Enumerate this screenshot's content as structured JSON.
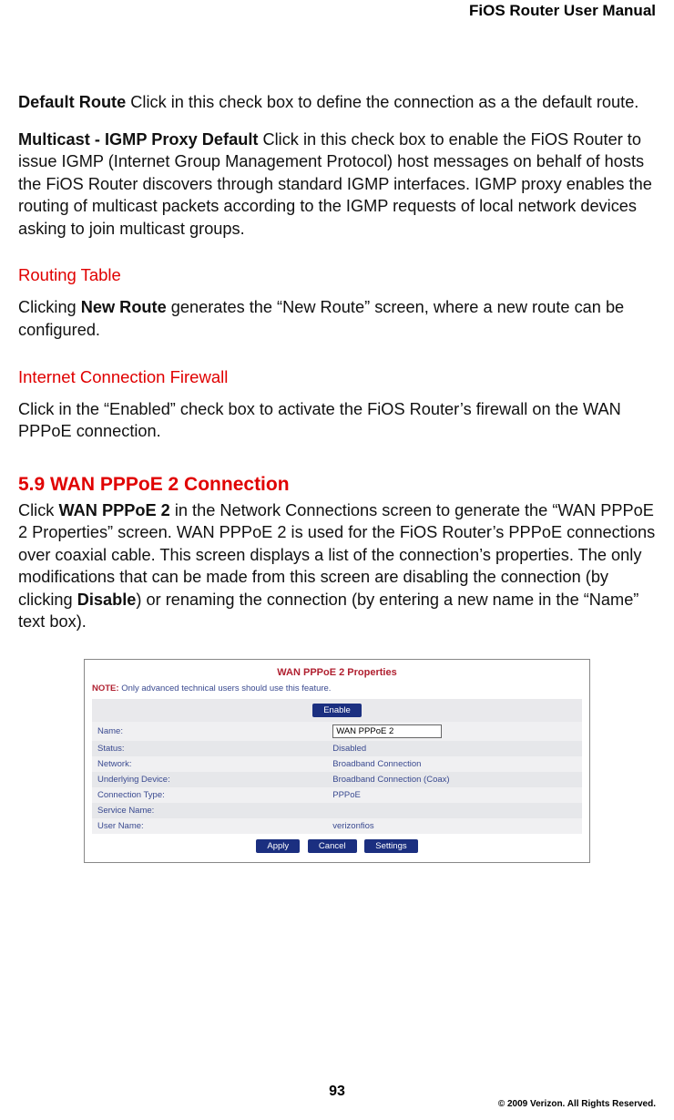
{
  "header": {
    "title": "FiOS Router User Manual"
  },
  "p1_bold": "Default Route",
  "p1_rest": "  Click in this check box to define the connection as a the default route.",
  "p2_bold": "Multicast - IGMP Proxy Default",
  "p2_rest": "  Click in this check box to enable the FiOS Router to issue IGMP (Internet Group Management Protocol) host messages on behalf of hosts the FiOS Router discovers through standard IGMP interfaces. IGMP proxy enables the routing of multicast packets according to the IGMP requests of local network devices asking to join multicast groups.",
  "routing_table_head": "Routing Table",
  "p3a": "Clicking ",
  "p3b": "New Route",
  "p3c": " generates the “New Route” screen, where a new route can be configured.",
  "icf_head": "Internet Connection Firewall",
  "p4": "Click in the “Enabled” check box to activate the FiOS Router’s firewall on the WAN PPPoE connection.",
  "sec59": "5.9  WAN PPPoE 2 Connection",
  "p5a": "Click ",
  "p5b": "WAN PPPoE 2",
  "p5c": " in the Network Connections screen to generate the “WAN PPPoE 2 Properties” screen.  WAN PPPoE 2 is used for the FiOS Router’s PPPoE connections over coaxial cable. This screen displays a list of the connection’s properties. The only modifications that can be made from this screen are disabling the connection (by clicking ",
  "p5d": "Disable",
  "p5e": ") or renaming the connection (by entering a new name in the “Name” text box).",
  "ss": {
    "title": "WAN PPPoE 2 Properties",
    "note_label": "NOTE:",
    "note_text": " Only advanced technical users should use this feature.",
    "enable_btn": "Enable",
    "rows": [
      {
        "k": "Name:",
        "v": "WAN PPPoE 2",
        "input": true
      },
      {
        "k": "Status:",
        "v": "Disabled"
      },
      {
        "k": "Network:",
        "v": "Broadband Connection"
      },
      {
        "k": "Underlying Device:",
        "v": "Broadband Connection (Coax)"
      },
      {
        "k": "Connection Type:",
        "v": "PPPoE"
      },
      {
        "k": "Service Name:",
        "v": ""
      },
      {
        "k": "User Name:",
        "v": "verizonfios"
      }
    ],
    "btns": {
      "apply": "Apply",
      "cancel": "Cancel",
      "settings": "Settings"
    }
  },
  "page_num": "93",
  "copyright": "© 2009 Verizon. All Rights Reserved."
}
